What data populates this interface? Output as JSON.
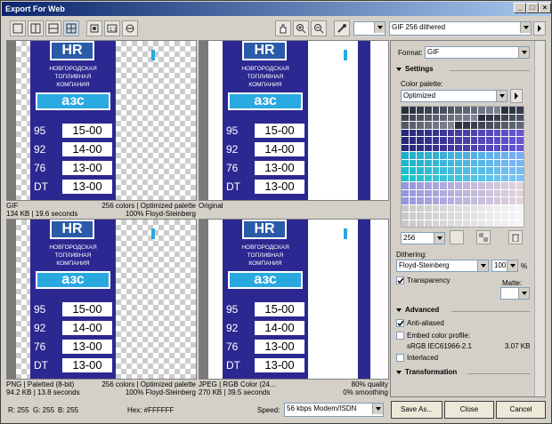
{
  "window": {
    "title": "Export For Web"
  },
  "titlebar_buttons": [
    "minimize",
    "maximize",
    "close"
  ],
  "top_right": {
    "preset": "GIF 256 dithered"
  },
  "format": {
    "label": "Format:",
    "value": "GIF"
  },
  "settings": {
    "header": "Settings",
    "palette_label": "Color palette:",
    "palette_value": "Optimized",
    "colors_value": "256",
    "dithering_label": "Dithering:",
    "dithering_value": "Floyd-Steinberg",
    "dithering_amount": "100",
    "percent": "%",
    "transparency_label": "Transparency",
    "matte_label": "Matte:"
  },
  "advanced": {
    "header": "Advanced",
    "anti_aliased": "Anti-aliased",
    "embed_label": "Embed color profile:",
    "profile_name": "sRGB IEC61966-2.1",
    "profile_size": "3.07 KB",
    "interlaced": "Interlaced"
  },
  "transformation": {
    "header": "Transformation"
  },
  "sign": {
    "line1": "НОВГОРОДСКАЯ",
    "line2": "ТОПЛИВНАЯ",
    "line3": "КОМПАНИЯ",
    "azs": "азс",
    "fuels": [
      {
        "grade": "95",
        "price": "15-00"
      },
      {
        "grade": "92",
        "price": "14-00"
      },
      {
        "grade": "76",
        "price": "13-00"
      },
      {
        "grade": "DT",
        "price": "13-00"
      }
    ]
  },
  "panes": [
    {
      "l1": "GIF",
      "r1": "256 colors  |  Optimized palette",
      "l2": "134 KB  |  19.6 seconds",
      "r2": "100% Floyd-Steinberg"
    },
    {
      "l1": "Original",
      "r1": "",
      "l2": "",
      "r2": ""
    },
    {
      "l1": "PNG  |  Paletted (8-bit)",
      "r1": "256 colors  |  Optimized palette",
      "l2": "94.2 KB  |  13.8 seconds",
      "r2": "100% Floyd-Steinberg"
    },
    {
      "l1": "JPEG  |  RGB Color (24...",
      "r1": "80% quality",
      "l2": "270 KB  |  39.5 seconds",
      "r2": "0% smoothing"
    }
  ],
  "status": {
    "r": "R: 255",
    "g": "G: 255",
    "b": "B: 255",
    "hex": "Hex: #FFFFFF",
    "speed_label": "Speed:",
    "speed_value": "56 kbps Modem/ISDN"
  },
  "buttons": {
    "save": "Save As...",
    "close": "Close",
    "cancel": "Cancel"
  },
  "colors": {
    "sign_blue": "#2c2891",
    "title_start": "#0a246a"
  }
}
